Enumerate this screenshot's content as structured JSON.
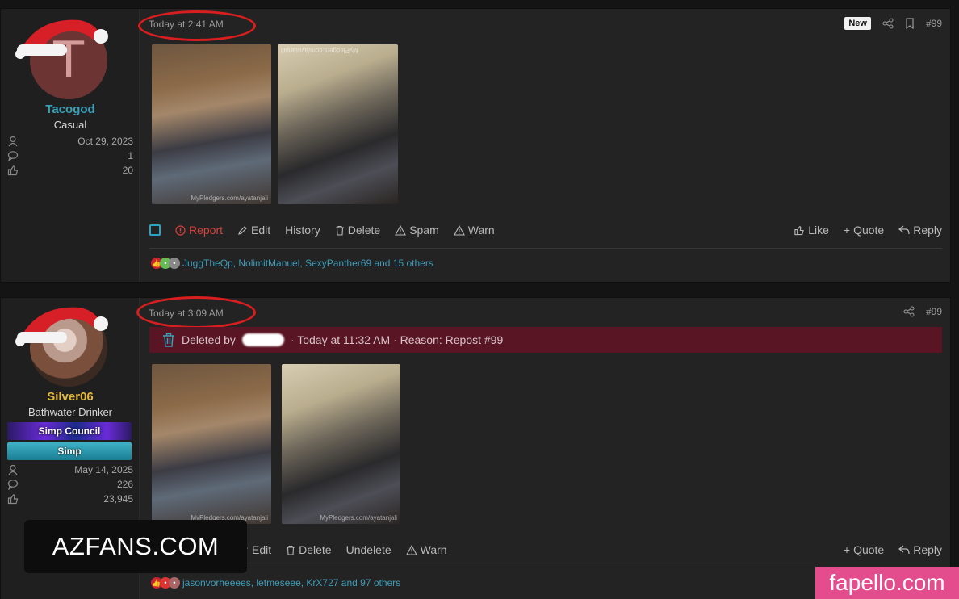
{
  "posts": [
    {
      "user": {
        "avatar_letter": "T",
        "username": "Tacogod",
        "username_color": "#3aa0b8",
        "title": "Casual",
        "stats": {
          "joined": "Oct 29, 2023",
          "messages": "1",
          "reactions": "20"
        }
      },
      "timestamp": "Today at 2:41 AM",
      "badge": "New",
      "post_number": "#99",
      "images": [
        {
          "watermark": "MyPledgers.com/ayatanjali"
        },
        {
          "watermark": "MyPledgers.com/ayatanjali"
        }
      ],
      "actions_left": [
        "Report",
        "Edit",
        "History",
        "Delete",
        "Spam",
        "Warn"
      ],
      "actions_right": [
        "Like",
        "Quote",
        "Reply"
      ],
      "reactions_text": "JuggTheQp, NolimitManuel, SexyPanther69 and 15 others"
    },
    {
      "user": {
        "username": "Silver06",
        "username_color": "#e6b83a",
        "title": "Bathwater Drinker",
        "banners": [
          "Simp Council",
          "Simp"
        ],
        "stats": {
          "joined": "May 14, 2025",
          "messages": "226",
          "reactions": "23,945"
        }
      },
      "timestamp": "Today at 3:09 AM",
      "post_number": "#99",
      "deleted_notice": {
        "prefix": "Deleted by",
        "suffix": "· Today at 11:32 AM · Reason: Repost #99"
      },
      "images": [
        {
          "watermark": "MyPledgers.com/ayatanjali"
        },
        {
          "watermark": "MyPledgers.com/ayatanjali"
        }
      ],
      "actions_left": [
        "Edit",
        "Delete",
        "Undelete",
        "Warn"
      ],
      "actions_right": [
        "Quote",
        "Reply"
      ],
      "reactions_text": "jasonvorheeees, letmeseee, KrX727 and 97 others"
    }
  ],
  "watermarks": {
    "azfans": "AZFANS.COM",
    "fapello": "fapello.com"
  },
  "colors": {
    "accent": "#3aa0b8",
    "report": "#d9413b",
    "deleted_bg": "#5a1524",
    "highlight_ellipse": "#d81e1e"
  }
}
